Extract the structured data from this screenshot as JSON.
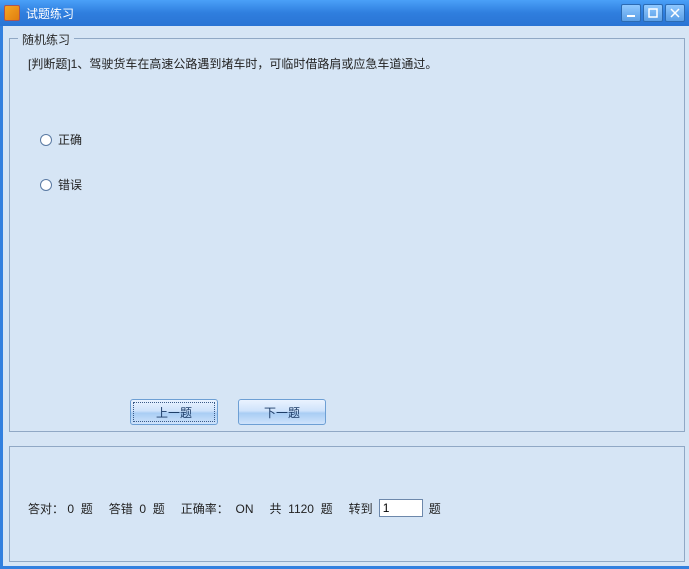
{
  "window": {
    "title": "试题练习"
  },
  "group": {
    "legend": "随机练习"
  },
  "question": {
    "prefix": "[判断题]",
    "number": "1、",
    "text": "驾驶货车在高速公路遇到堵车时，可临时借路肩或应急车道通过。"
  },
  "options": {
    "opt1": "正确",
    "opt2": "错误"
  },
  "buttons": {
    "prev": "上一题",
    "next": "下一题"
  },
  "status": {
    "correct_label": "答对：",
    "correct_val": "0",
    "unit_q": "题",
    "wrong_label": "答错",
    "wrong_val": "0",
    "rate_label": "正确率：",
    "rate_val": "ON",
    "total_label": "共",
    "total_val": "1120",
    "goto_label": "转到",
    "goto_val": "1",
    "goto_suffix": "题"
  }
}
